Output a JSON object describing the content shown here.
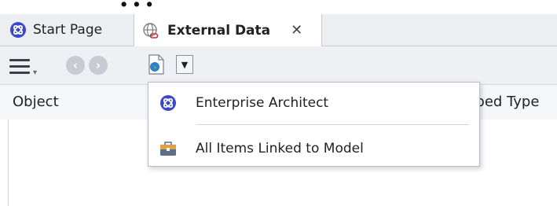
{
  "window": {
    "header_cut_text": "..."
  },
  "tabs": [
    {
      "label": "Start Page",
      "icon": "ea-logo-icon",
      "active": false
    },
    {
      "label": "External Data",
      "icon": "globe-link-icon",
      "active": true,
      "close": "✕"
    }
  ],
  "toolbar": {
    "menu_icon": "hamburger-icon",
    "back_icon": "back-arrow-icon",
    "forward_icon": "forward-arrow-icon",
    "source_icon": "document-globe-icon",
    "dropdown_glyph": "▼"
  },
  "grid": {
    "columns": [
      "Object",
      "pped Type"
    ]
  },
  "menu": {
    "items": [
      {
        "label": "Enterprise Architect",
        "icon": "ea-logo-icon"
      },
      {
        "label": "All Items Linked to Model",
        "icon": "briefcase-icon"
      }
    ]
  },
  "colors": {
    "accent": "#3b49c9",
    "tabbar": "#eceef2",
    "toolbar": "#eef0f3"
  }
}
